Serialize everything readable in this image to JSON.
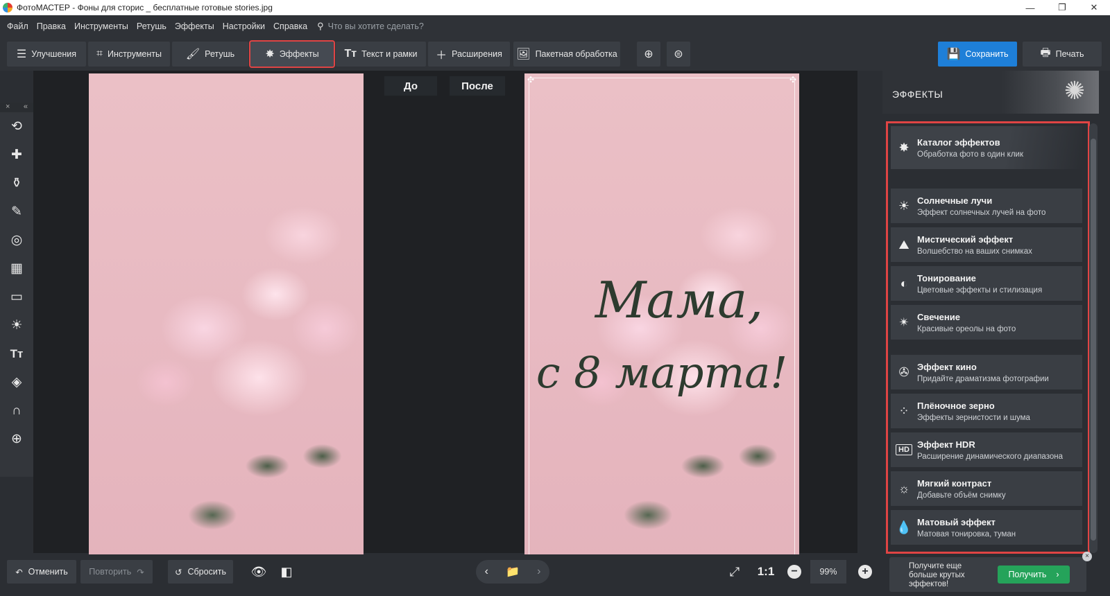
{
  "window": {
    "title": "ФотоМАСТЕР - Фоны для сторис _ бесплатные готовые stories.jpg",
    "min": "—",
    "restore": "❐",
    "close": "✕"
  },
  "menu": {
    "items": [
      "Файл",
      "Правка",
      "Инструменты",
      "Ретушь",
      "Эффекты",
      "Настройки",
      "Справка"
    ],
    "search_placeholder": "Что вы хотите сделать?"
  },
  "toolbar": {
    "tabs": [
      {
        "label": "Улучшения",
        "icon": "sliders-icon"
      },
      {
        "label": "Инструменты",
        "icon": "crop-icon"
      },
      {
        "label": "Ретушь",
        "icon": "brush-icon"
      },
      {
        "label": "Эффекты",
        "icon": "magic-wand-icon",
        "active": true
      },
      {
        "label": "Текст и рамки",
        "icon": "text-icon"
      },
      {
        "label": "Расширения",
        "icon": "plus-icon"
      },
      {
        "label": "Пакетная обработка",
        "icon": "batch-icon"
      }
    ],
    "save": "Сохранить",
    "print": "Печать"
  },
  "canvas": {
    "before_label": "До",
    "after_label": "После",
    "greeting_line1": "Мама,",
    "greeting_line2": "с 8 марта!"
  },
  "effects_panel": {
    "title": "ЭФФЕКТЫ",
    "items": [
      {
        "title": "Каталог эффектов",
        "subtitle": "Обработка фото в один клик",
        "icon": "magic-wand-icon"
      },
      {
        "title": "Солнечные лучи",
        "subtitle": "Эффект солнечных лучей на фото",
        "icon": "sun-icon"
      },
      {
        "title": "Мистический эффект",
        "subtitle": "Волшебство на ваших снимках",
        "icon": "mystic-icon"
      },
      {
        "title": "Тонирование",
        "subtitle": "Цветовые эффекты и стилизация",
        "icon": "half-circle-icon"
      },
      {
        "title": "Свечение",
        "subtitle": "Красивые ореолы на фото",
        "icon": "glow-icon"
      },
      {
        "title": "Эффект кино",
        "subtitle": "Придайте драматизма фотографии",
        "icon": "film-reel-icon"
      },
      {
        "title": "Плёночное зерно",
        "subtitle": "Эффекты зернистости и шума",
        "icon": "grain-icon"
      },
      {
        "title": "Эффект HDR",
        "subtitle": "Расширение динамического диапазона",
        "icon": "hdr-icon"
      },
      {
        "title": "Мягкий контраст",
        "subtitle": "Добавьте объём снимку",
        "icon": "soft-contrast-icon"
      },
      {
        "title": "Матовый эффект",
        "subtitle": "Матовая тонировка, туман",
        "icon": "drop-icon"
      }
    ],
    "promo_text": "Получите еще больше крутых эффектов!",
    "promo_button": "Получить"
  },
  "bottom": {
    "undo": "Отменить",
    "redo": "Повторить",
    "reset": "Сбросить",
    "ratio": "1:1",
    "zoom": "99%"
  },
  "colors": {
    "accent": "#1e7fd8",
    "highlight": "#e04444",
    "promo_green": "#25a35a",
    "panel": "#2b2e33"
  }
}
